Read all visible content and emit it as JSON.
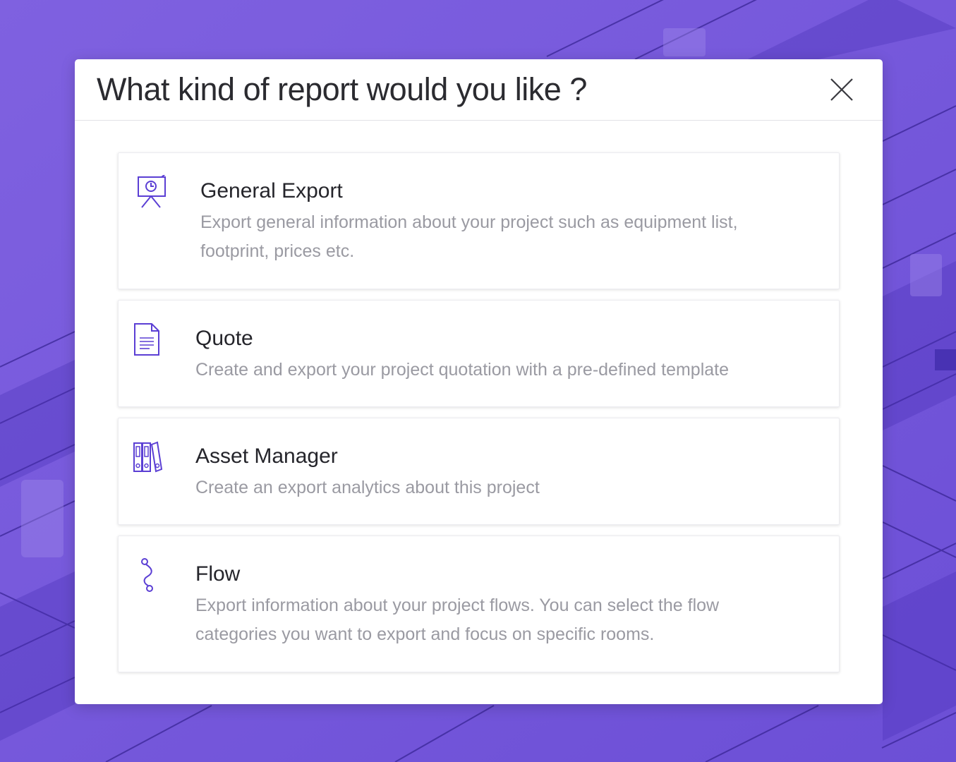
{
  "dialog": {
    "title": "What kind of report would you like ?",
    "close_icon": "close-icon"
  },
  "options": [
    {
      "id": "general-export",
      "title": "General Export",
      "description": "Export general information about your project such as equipment list, footprint, prices etc.",
      "icon": "presentation-board-icon"
    },
    {
      "id": "quote",
      "title": "Quote",
      "description": "Create and export your project quotation with a pre-defined template",
      "icon": "document-icon"
    },
    {
      "id": "asset-manager",
      "title": "Asset Manager",
      "description": "Create an export analytics about this project",
      "icon": "binders-icon"
    },
    {
      "id": "flow",
      "title": "Flow",
      "description": "Export information about your project flows. You can select the flow categories you want to export and focus on specific rooms.",
      "icon": "flow-path-icon"
    }
  ],
  "colors": {
    "background": "#7a5bdc",
    "accent": "#5b3fd4",
    "title_text": "#2b2b30",
    "description_text": "#9a9aa2"
  }
}
